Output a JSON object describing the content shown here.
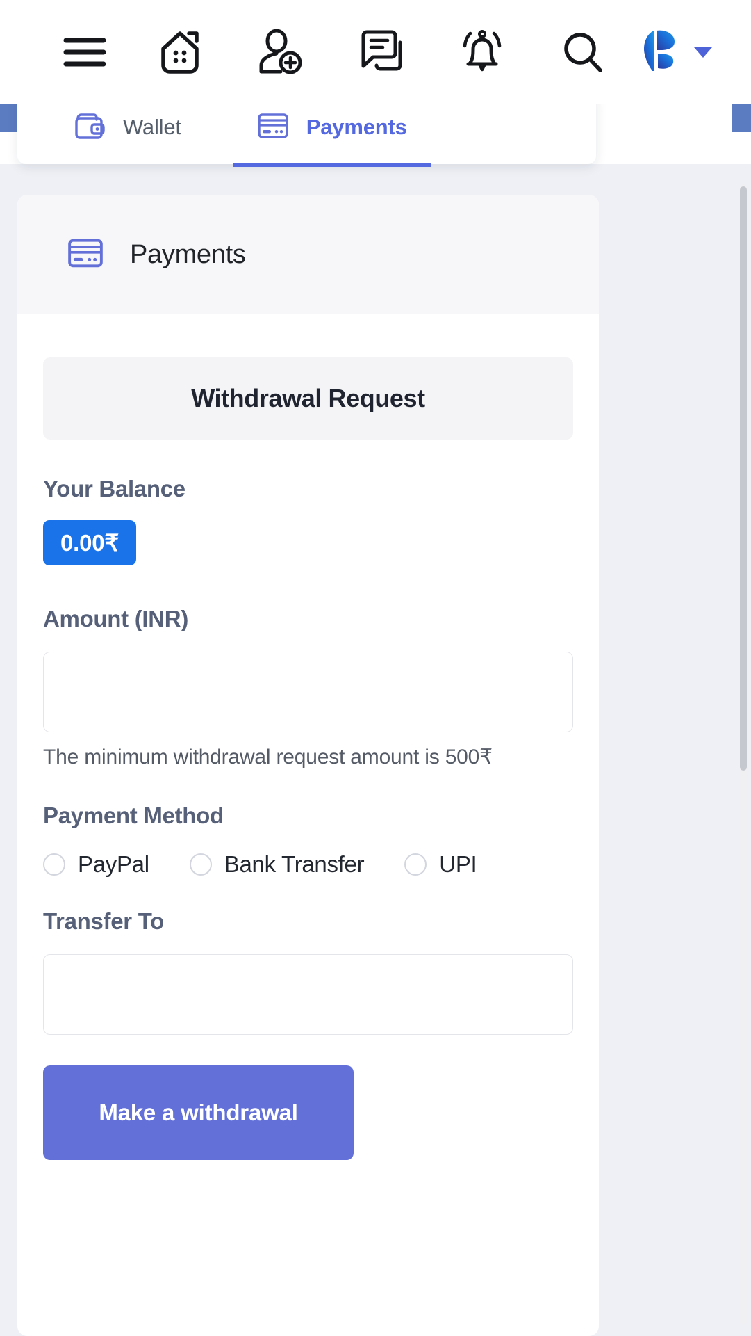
{
  "navbar": {
    "items": [
      {
        "name": "menu",
        "label": "Menu"
      },
      {
        "name": "home",
        "label": "Home"
      },
      {
        "name": "add-friend",
        "label": "Add Friend"
      },
      {
        "name": "messages",
        "label": "Messages"
      },
      {
        "name": "notifications",
        "label": "Notifications"
      },
      {
        "name": "search",
        "label": "Search"
      }
    ],
    "brand": {
      "label": "Profile",
      "accent": "#1a73e8",
      "caret_color": "#4f63d8"
    }
  },
  "tabs": [
    {
      "id": "wallet",
      "label": "Wallet",
      "icon": "wallet-icon",
      "active": false
    },
    {
      "id": "payments",
      "label": "Payments",
      "icon": "credit-card-icon",
      "active": true
    }
  ],
  "card": {
    "header": {
      "title": "Payments",
      "icon": "credit-card-icon"
    },
    "form": {
      "title": "Withdrawal Request",
      "balance": {
        "label": "Your Balance",
        "value": "0.00₹",
        "badge_color": "#1a73e8"
      },
      "amount": {
        "label": "Amount (INR)",
        "value": "",
        "placeholder": "",
        "helper": "The minimum withdrawal request amount is 500₹"
      },
      "payment_method": {
        "label": "Payment Method",
        "options": [
          {
            "id": "paypal",
            "label": "PayPal",
            "selected": false
          },
          {
            "id": "bank-transfer",
            "label": "Bank Transfer",
            "selected": false
          },
          {
            "id": "upi",
            "label": "UPI",
            "selected": false
          }
        ]
      },
      "transfer_to": {
        "label": "Transfer To",
        "value": "",
        "placeholder": ""
      },
      "submit": {
        "label": "Make a withdrawal",
        "color": "#6270d8"
      }
    }
  },
  "theme": {
    "page_bg": "#eef0f5",
    "tab_active": "#5468e0",
    "tab_inactive": "#555e6b",
    "label_color": "#566078"
  }
}
